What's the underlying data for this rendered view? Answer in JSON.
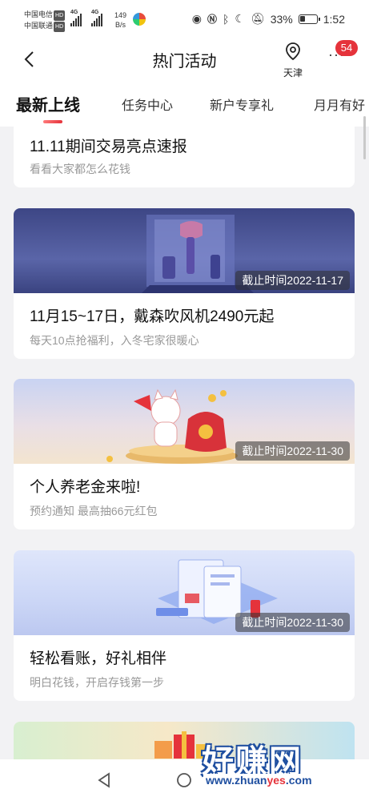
{
  "status_bar": {
    "carrier1": "中国电信",
    "carrier2": "中国联通",
    "hd": "HD",
    "net1": "4G",
    "net2": "4G",
    "speed_value": "149",
    "speed_unit": "B/s",
    "battery": "33%",
    "time": "1:52"
  },
  "header": {
    "title": "热门活动",
    "location": "天津",
    "more_label": "···",
    "badge": "54"
  },
  "tabs": [
    {
      "label": "最新上线",
      "active": true
    },
    {
      "label": "任务中心",
      "active": false
    },
    {
      "label": "新户专享礼",
      "active": false
    },
    {
      "label": "月月有好",
      "active": false
    }
  ],
  "cards": [
    {
      "title": "11.11期间交易亮点速报",
      "subtitle": "看看大家都怎么花钱"
    },
    {
      "title": "11月15~17日，戴森吹风机2490元起",
      "subtitle": "每天10点抢福利，入冬宅家很暖心",
      "deadline": "截止时间2022-11-17"
    },
    {
      "title": "个人养老金来啦!",
      "subtitle": "预约通知  最高抽66元红包",
      "deadline": "截止时间2022-11-30"
    },
    {
      "title": "轻松看账，好礼相伴",
      "subtitle": "明白花钱，开启存钱第一步",
      "deadline": "截止时间2022-11-30"
    }
  ],
  "watermark": {
    "text": "好赚网",
    "url_a": "www.zhuan",
    "url_b": "yes",
    "url_c": ".com"
  },
  "colors": {
    "accent": "#e5333b",
    "watermark": "#1f4fa0"
  }
}
